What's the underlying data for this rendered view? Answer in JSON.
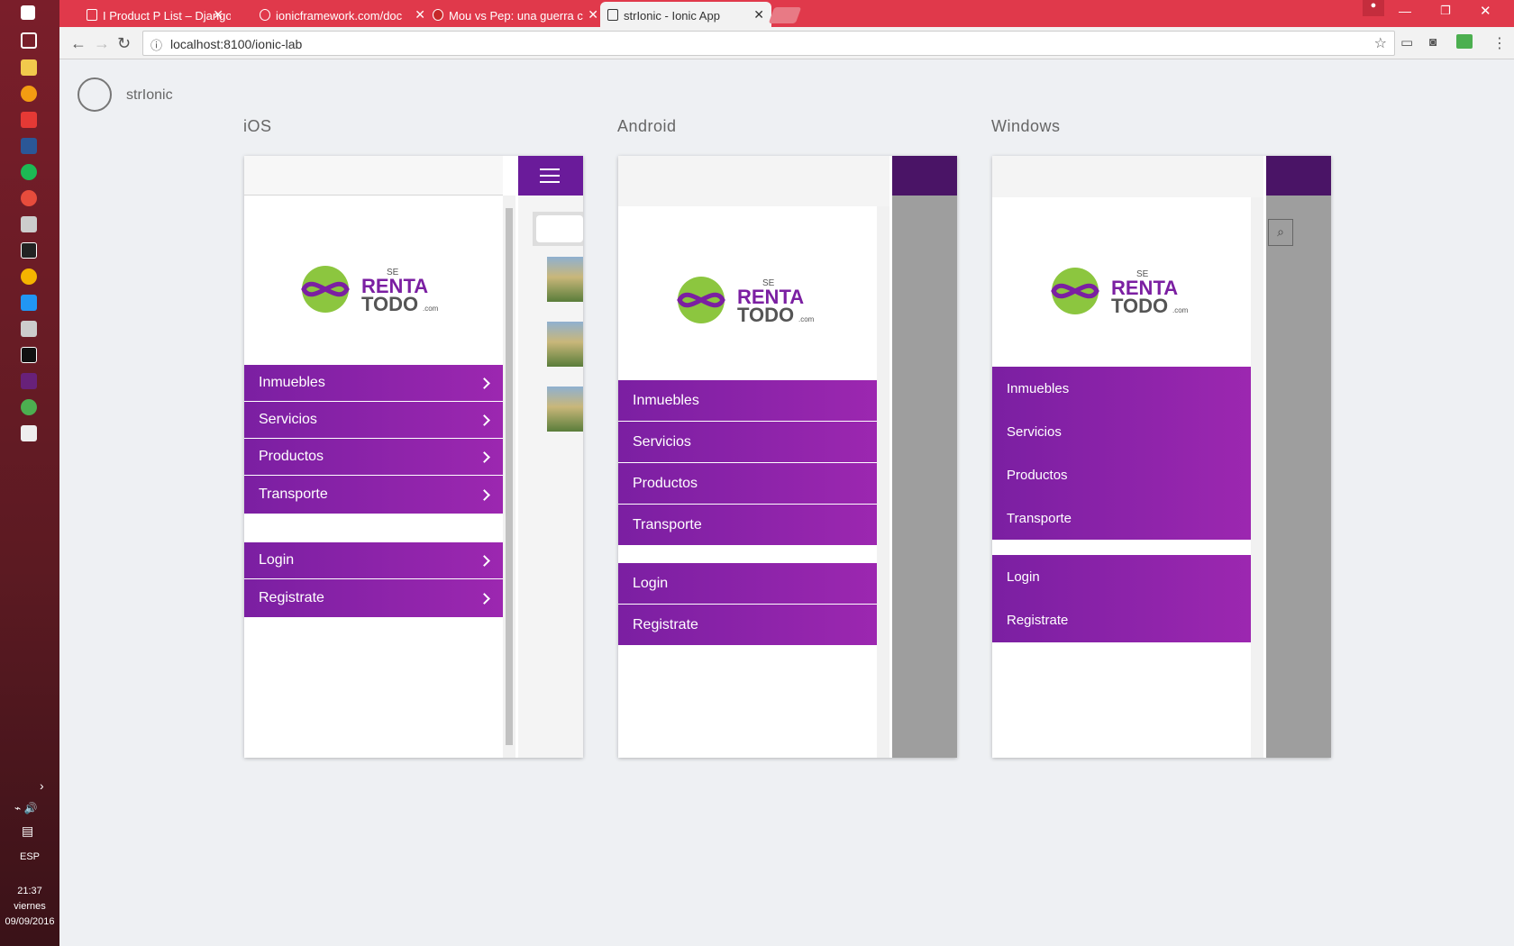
{
  "taskbar": {
    "lang": "ESP",
    "time": "21:37",
    "day": "viernes",
    "date": "09/09/2016"
  },
  "browser": {
    "tabs": [
      {
        "title": "I Product P List – Django",
        "active": false
      },
      {
        "title": "ionicframework.com/doc",
        "active": false
      },
      {
        "title": "Mou vs Pep: una guerra c",
        "active": false
      },
      {
        "title": "strIonic - Ionic App",
        "active": true
      }
    ],
    "url": "localhost:8100/ionic-lab"
  },
  "lab": {
    "app_name": "strIonic"
  },
  "platforms": [
    {
      "name": "iOS",
      "items": [
        "Inmuebles",
        "Servicios",
        "Productos",
        "Transporte"
      ],
      "auth": [
        "Login",
        "Registrate"
      ]
    },
    {
      "name": "Android",
      "items": [
        "Inmuebles",
        "Servicios",
        "Productos",
        "Transporte"
      ],
      "auth": [
        "Login",
        "Registrate"
      ]
    },
    {
      "name": "Windows",
      "items": [
        "Inmuebles",
        "Servicios",
        "Productos",
        "Transporte"
      ],
      "auth": [
        "Login",
        "Registrate"
      ]
    }
  ],
  "logo": {
    "se": "SE",
    "renta": "RENTA",
    "todo": "TODO",
    "com": ".com"
  },
  "colors": {
    "brand_purple": "#7b1fa2",
    "tab_red": "#e0394b",
    "logo_green": "#8cc63f"
  }
}
